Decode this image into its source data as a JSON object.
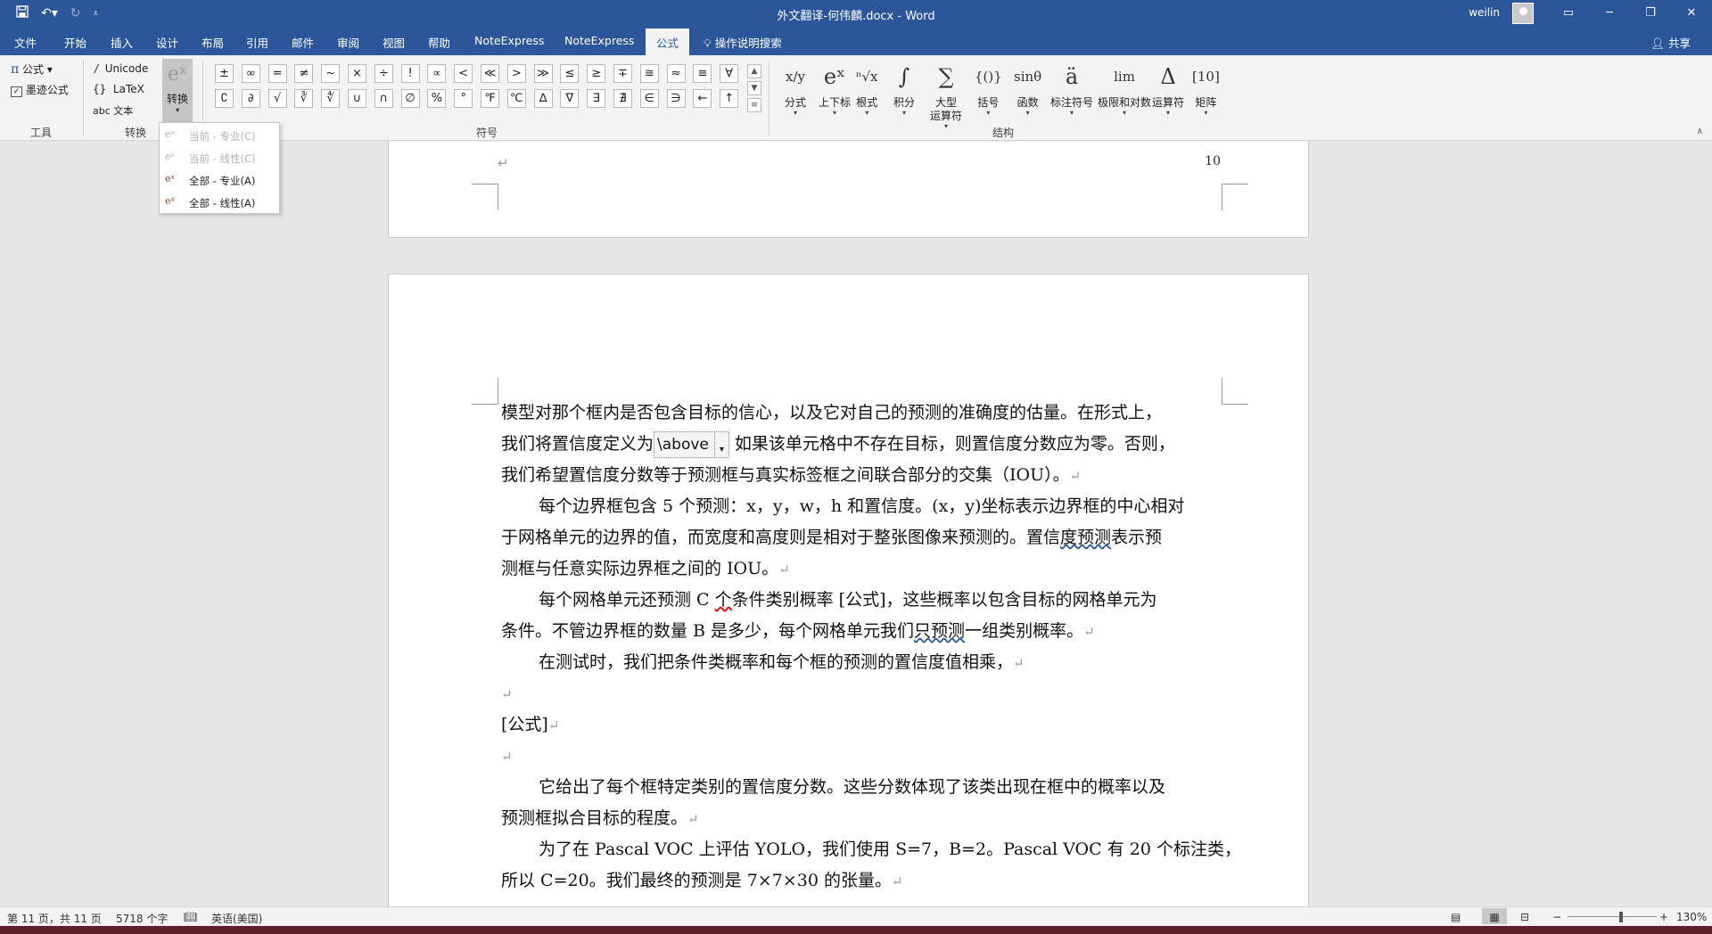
{
  "titlebar": {
    "title": "外文翻译-何伟麟.docx  -  Word",
    "user": "weilin",
    "minimize": "─",
    "restore": "❐",
    "close": "✕",
    "ribbon_display": "▭"
  },
  "tabs": [
    "文件",
    "开始",
    "插入",
    "设计",
    "布局",
    "引用",
    "邮件",
    "审阅",
    "视图",
    "帮助",
    "NoteExpress",
    "NoteExpress",
    "公式"
  ],
  "tell_me": "操作说明搜索",
  "share": "共享",
  "ribbon": {
    "tools": {
      "equation": "公式",
      "ink_equation": "墨迹公式",
      "label": "工具"
    },
    "convert": {
      "unicode": "Unicode",
      "latex": "LaTeX",
      "text": "abc 文本",
      "convert_btn": "转换",
      "label": "转换"
    },
    "symbols": {
      "row1": [
        "±",
        "∞",
        "=",
        "≠",
        "~",
        "×",
        "÷",
        "!",
        "∝",
        "<",
        "≪",
        ">",
        "≫",
        "≤",
        "≥",
        "∓",
        "≅",
        "≈",
        "≡",
        "∀"
      ],
      "row2": [
        "∁",
        "∂",
        "√",
        "∛",
        "∜",
        "∪",
        "∩",
        "∅",
        "%",
        "°",
        "℉",
        "℃",
        "∆",
        "∇",
        "∃",
        "∄",
        "∈",
        "∋",
        "←",
        "↑"
      ],
      "label": "符号"
    },
    "structures": {
      "items": [
        {
          "icon": "x/y",
          "label": "分式"
        },
        {
          "icon": "eˣ",
          "label": "上下标"
        },
        {
          "icon": "ⁿ√x",
          "label": "根式"
        },
        {
          "icon": "∫",
          "label": "积分"
        },
        {
          "icon": "∑",
          "label": "大型\n运算符"
        },
        {
          "icon": "{()}",
          "label": "括号"
        },
        {
          "icon": "sinθ",
          "label": "函数"
        },
        {
          "icon": "ä",
          "label": "标注符号"
        },
        {
          "icon": "lim",
          "label": "极限和对数"
        },
        {
          "icon": "Δ",
          "label": "运算符"
        },
        {
          "icon": "[10]",
          "label": "矩阵"
        }
      ],
      "label": "结构"
    }
  },
  "convert_menu": [
    {
      "label": "当前 - 专业(C)",
      "enabled": false
    },
    {
      "label": "当前 - 线性(C)",
      "enabled": false
    },
    {
      "label": "全部 - 专业(A)",
      "enabled": true
    },
    {
      "label": "全部 - 线性(A)",
      "enabled": true
    }
  ],
  "page1": {
    "page_number": "10"
  },
  "document": {
    "line1": "模型对那个框内是否包含目标的信心，以及它对自己的预测的准确度的估量。在形式上，",
    "line2a": "我们将置信度定义为",
    "equation": "\\above",
    "line2b": " 如果该单元格中不存在目标，则置信度分数应为零。否则，",
    "line3": "我们希望置信度分数等于预测框与真实标签框之间联合部分的交集（IOU）。",
    "line4": "每个边界框包含 5 个预测：x，y，w，h 和置信度。(x，y)坐标表示边界框的中心相对",
    "line5a": "于网格单元的边界的值，而宽度和高度则是相对于整张图像来预测的。置信",
    "line5b": "度预测",
    "line5c": "表示预",
    "line6": "测框与任意实际边界框之间的 IOU。",
    "line7a": "每个网格单元还预测  C  ",
    "line7b": "个",
    "line7c": "条件类别概率  [公式]，这些概率以包含目标的网格单元为",
    "line8a": "条件。不管边界框的数量 B 是多少，每个网格单元我们",
    "line8b": "只预测",
    "line8c": "一组类别概率。",
    "line9": "在测试时，我们把条件类概率和每个框的预测的置信度值相乘，",
    "line11": "[公式]",
    "line13": "它给出了每个框特定类别的置信度分数。这些分数体现了该类出现在框中的概率以及",
    "line14": "预测框拟合目标的程度。",
    "line15": "为了在 Pascal VOC 上评估 YOLO，我们使用 S=7，B=2。Pascal VOC 有 20 个标注类，",
    "line16": "所以 C=20。我们最终的预测是 7×7×30 的张量。",
    "para_mark": "↵"
  },
  "status": {
    "page": "第 11 页，共 11 页",
    "words": "5718 个字",
    "language": "英语(美国)",
    "zoom": "130%",
    "zoom_fraction": 0.6
  }
}
